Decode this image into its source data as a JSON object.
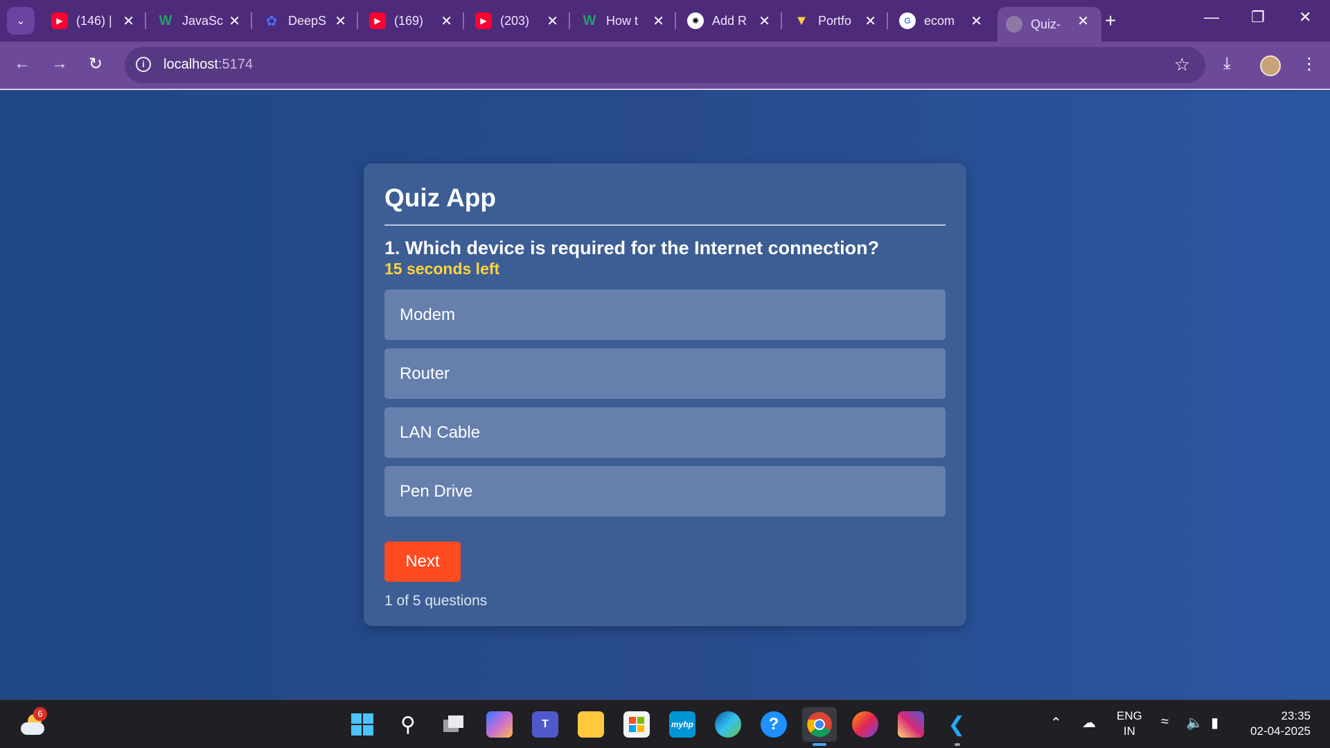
{
  "browser": {
    "tabs": [
      {
        "title": "(146) |",
        "favicon": "youtube-icon"
      },
      {
        "title": "JavaSc",
        "favicon": "w3schools-icon"
      },
      {
        "title": "DeepS",
        "favicon": "deepseek-icon"
      },
      {
        "title": "(169)",
        "favicon": "youtube-icon"
      },
      {
        "title": "(203)",
        "favicon": "youtube-icon"
      },
      {
        "title": "How t",
        "favicon": "w3schools-icon"
      },
      {
        "title": "Add R",
        "favicon": "chatgpt-icon"
      },
      {
        "title": "Portfo",
        "favicon": "vite-icon"
      },
      {
        "title": "ecom",
        "favicon": "google-icon"
      },
      {
        "title": "Quiz-",
        "favicon": "globe-icon",
        "active": true
      }
    ],
    "address": {
      "host": "localhost",
      "port": ":5174"
    }
  },
  "quiz": {
    "app_title": "Quiz App",
    "question": "1. Which device is required for the Internet connection?",
    "timer": "15 seconds left",
    "options": [
      "Modem",
      "Router",
      "LAN Cable",
      "Pen Drive"
    ],
    "next_label": "Next",
    "progress": "1 of 5 questions"
  },
  "taskbar": {
    "weather_badge": "6",
    "language": {
      "line1": "ENG",
      "line2": "IN"
    },
    "time": "23:35",
    "date": "02-04-2025"
  },
  "colors": {
    "page_bg": "#24478a",
    "card_bg": "#3d5e94",
    "option_bg": "#667fac",
    "timer": "#ffd43b",
    "next_button": "#ff4a20",
    "browser_frame": "#4d2a7a"
  }
}
